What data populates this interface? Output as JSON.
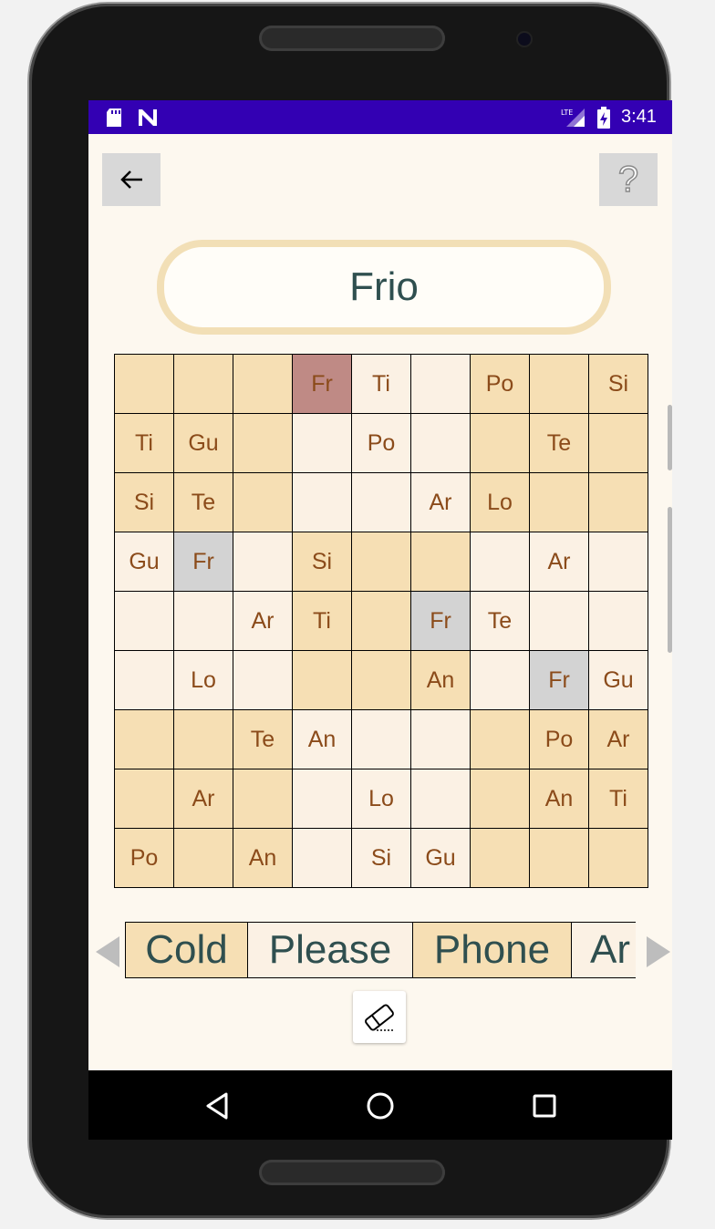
{
  "status": {
    "time": "3:41",
    "network": "LTE",
    "icons": [
      "sd-card-icon",
      "n-notification-icon",
      "lte-signal-icon",
      "battery-charging-icon"
    ]
  },
  "toolbar": {
    "back_icon": "arrow-left-icon",
    "help_icon": "question-mark-icon",
    "help_label": "?"
  },
  "current_word": "Frio",
  "grid": {
    "rows": [
      [
        {
          "t": "",
          "c": "d"
        },
        {
          "t": "",
          "c": "d"
        },
        {
          "t": "",
          "c": "d"
        },
        {
          "t": "Fr",
          "c": "h"
        },
        {
          "t": "Ti",
          "c": "l"
        },
        {
          "t": "",
          "c": "l"
        },
        {
          "t": "Po",
          "c": "d"
        },
        {
          "t": "",
          "c": "d"
        },
        {
          "t": "Si",
          "c": "d"
        }
      ],
      [
        {
          "t": "Ti",
          "c": "d"
        },
        {
          "t": "Gu",
          "c": "d"
        },
        {
          "t": "",
          "c": "d"
        },
        {
          "t": "",
          "c": "l"
        },
        {
          "t": "Po",
          "c": "l"
        },
        {
          "t": "",
          "c": "l"
        },
        {
          "t": "",
          "c": "d"
        },
        {
          "t": "Te",
          "c": "d"
        },
        {
          "t": "",
          "c": "d"
        }
      ],
      [
        {
          "t": "Si",
          "c": "d"
        },
        {
          "t": "Te",
          "c": "d"
        },
        {
          "t": "",
          "c": "d"
        },
        {
          "t": "",
          "c": "l"
        },
        {
          "t": "",
          "c": "l"
        },
        {
          "t": "Ar",
          "c": "l"
        },
        {
          "t": "Lo",
          "c": "d"
        },
        {
          "t": "",
          "c": "d"
        },
        {
          "t": "",
          "c": "d"
        }
      ],
      [
        {
          "t": "Gu",
          "c": "l"
        },
        {
          "t": "Fr",
          "c": "s"
        },
        {
          "t": "",
          "c": "l"
        },
        {
          "t": "Si",
          "c": "d"
        },
        {
          "t": "",
          "c": "d"
        },
        {
          "t": "",
          "c": "d"
        },
        {
          "t": "",
          "c": "l"
        },
        {
          "t": "Ar",
          "c": "l"
        },
        {
          "t": "",
          "c": "l"
        }
      ],
      [
        {
          "t": "",
          "c": "l"
        },
        {
          "t": "",
          "c": "l"
        },
        {
          "t": "Ar",
          "c": "l"
        },
        {
          "t": "Ti",
          "c": "d"
        },
        {
          "t": "",
          "c": "d"
        },
        {
          "t": "Fr",
          "c": "s"
        },
        {
          "t": "Te",
          "c": "l"
        },
        {
          "t": "",
          "c": "l"
        },
        {
          "t": "",
          "c": "l"
        }
      ],
      [
        {
          "t": "",
          "c": "l"
        },
        {
          "t": "Lo",
          "c": "l"
        },
        {
          "t": "",
          "c": "l"
        },
        {
          "t": "",
          "c": "d"
        },
        {
          "t": "",
          "c": "d"
        },
        {
          "t": "An",
          "c": "d"
        },
        {
          "t": "",
          "c": "l"
        },
        {
          "t": "Fr",
          "c": "s"
        },
        {
          "t": "Gu",
          "c": "l"
        }
      ],
      [
        {
          "t": "",
          "c": "d"
        },
        {
          "t": "",
          "c": "d"
        },
        {
          "t": "Te",
          "c": "d"
        },
        {
          "t": "An",
          "c": "l"
        },
        {
          "t": "",
          "c": "l"
        },
        {
          "t": "",
          "c": "l"
        },
        {
          "t": "",
          "c": "d"
        },
        {
          "t": "Po",
          "c": "d"
        },
        {
          "t": "Ar",
          "c": "d"
        }
      ],
      [
        {
          "t": "",
          "c": "d"
        },
        {
          "t": "Ar",
          "c": "d"
        },
        {
          "t": "",
          "c": "d"
        },
        {
          "t": "",
          "c": "l"
        },
        {
          "t": "Lo",
          "c": "l"
        },
        {
          "t": "",
          "c": "l"
        },
        {
          "t": "",
          "c": "d"
        },
        {
          "t": "An",
          "c": "d"
        },
        {
          "t": "Ti",
          "c": "d"
        }
      ],
      [
        {
          "t": "Po",
          "c": "d"
        },
        {
          "t": "",
          "c": "d"
        },
        {
          "t": "An",
          "c": "d"
        },
        {
          "t": "",
          "c": "l"
        },
        {
          "t": "Si",
          "c": "l"
        },
        {
          "t": "Gu",
          "c": "l"
        },
        {
          "t": "",
          "c": "d"
        },
        {
          "t": "",
          "c": "d"
        },
        {
          "t": "",
          "c": "d"
        }
      ]
    ]
  },
  "choices": [
    {
      "label": "Cold",
      "c": "d"
    },
    {
      "label": "Please",
      "c": "l"
    },
    {
      "label": "Phone",
      "c": "d"
    },
    {
      "label": "Ar",
      "c": "l"
    }
  ],
  "choice_nav": {
    "prev_icon": "triangle-left-icon",
    "next_icon": "triangle-right-icon"
  },
  "eraser_icon": "eraser-icon",
  "nav": {
    "back_icon": "nav-back-icon",
    "home_icon": "nav-home-icon",
    "recents_icon": "nav-recents-icon"
  },
  "colors": {
    "status_bar": "#3300b3",
    "app_bg": "#fdf8ef",
    "cell_dark": "#f6dfb4",
    "cell_light": "#fbf1e4",
    "cell_selected": "#d3d3d3",
    "cell_highlight": "#bf8a85",
    "cell_text": "#8b4b1a",
    "word_text": "#2f4f4f"
  }
}
